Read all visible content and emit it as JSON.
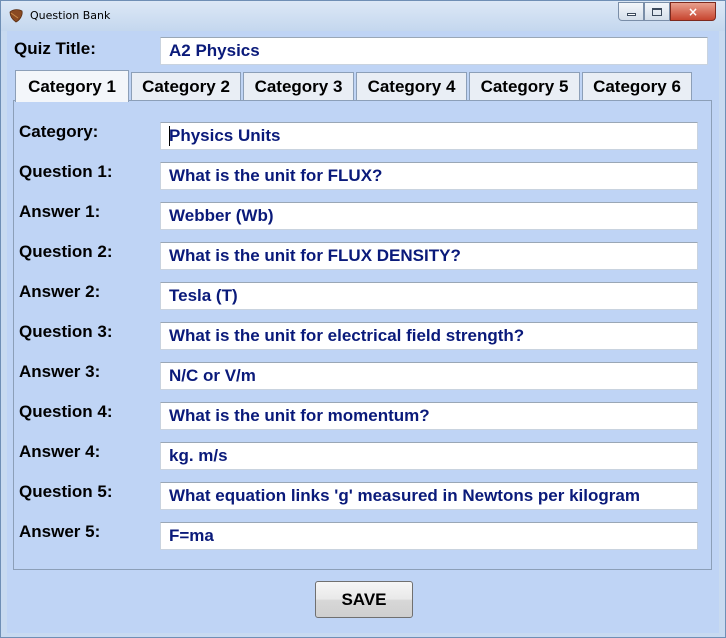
{
  "window": {
    "title": "Question Bank",
    "controls": {
      "minimize": "minimize",
      "maximize": "maximize",
      "close": "×"
    }
  },
  "quiz": {
    "title_label": "Quiz Title:",
    "title_value": "A2 Physics"
  },
  "tabs": [
    {
      "label": "Category 1",
      "active": true
    },
    {
      "label": "Category 2",
      "active": false
    },
    {
      "label": "Category 3",
      "active": false
    },
    {
      "label": "Category 4",
      "active": false
    },
    {
      "label": "Category 5",
      "active": false
    },
    {
      "label": "Category 6",
      "active": false
    }
  ],
  "category": {
    "label": "Category:",
    "value": "Physics Units"
  },
  "rows": [
    {
      "label": "Question 1:",
      "value": "What is the unit for FLUX?"
    },
    {
      "label": "Answer 1:",
      "value": "Webber (Wb)"
    },
    {
      "label": "Question 2:",
      "value": "What is the unit for FLUX DENSITY?"
    },
    {
      "label": "Answer 2:",
      "value": "Tesla (T)"
    },
    {
      "label": "Question 3:",
      "value": "What is the unit for electrical field strength?"
    },
    {
      "label": "Answer 3:",
      "value": "N/C or V/m"
    },
    {
      "label": "Question 4:",
      "value": "What is the unit for momentum?"
    },
    {
      "label": "Answer 4:",
      "value": "kg. m/s"
    },
    {
      "label": "Question 5:",
      "value": "What equation links 'g' measured in Newtons per kilogram"
    },
    {
      "label": "Answer 5:",
      "value": "F=ma"
    }
  ],
  "save_label": "SAVE",
  "colors": {
    "client_background": "#bfd4f5",
    "field_text": "#0a1a7a",
    "close_button": "#c7452f"
  },
  "icons": {
    "app": "leaf-icon"
  }
}
